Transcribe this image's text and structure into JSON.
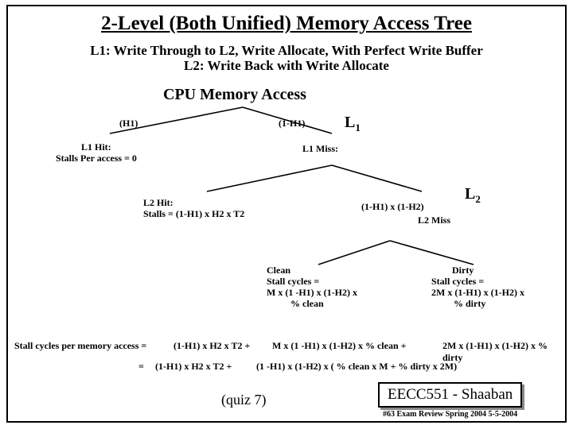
{
  "title": "2-Level (Both Unified) Memory Access Tree",
  "subtitle_line1": "L1: Write Through to L2, Write Allocate, With Perfect Write Buffer",
  "subtitle_line2": "L2: Write Back with Write Allocate",
  "section": "CPU Memory  Access",
  "labels": {
    "h1": "(H1)",
    "one_minus_h1": "(1-H1)",
    "L1": "L",
    "L1_sub": "1",
    "L2": "L",
    "L2_sub": "2",
    "l1_hit_line1": "L1 Hit:",
    "l1_hit_line2": "Stalls Per access = 0",
    "l1_miss": "L1 Miss:",
    "l2_hit_line1": "L2 Hit:",
    "l2_hit_line2": "Stalls =  (1-H1) x H2 x T2",
    "l2_right": "(1-H1) x (1-H2)",
    "l2_miss": "L2 Miss",
    "clean_line1": "Clean",
    "clean_line2": "Stall cycles =",
    "clean_line3": "M x (1 -H1)  x (1-H2) x",
    "clean_line4": "% clean",
    "dirty_line1": "Dirty",
    "dirty_line2": "Stall cycles =",
    "dirty_line3": "2M x (1-H1)  x (1-H2) x",
    "dirty_line4": "% dirty",
    "eq_lhs": "Stall cycles per memory access =",
    "eq_rhs1a": "(1-H1) x H2 x T2 +",
    "eq_rhs1b": "M x (1 -H1)  x (1-H2)  x  % clean   +",
    "eq_rhs1c": "2M x (1-H1)  x (1-H2) x % dirty",
    "eq_eq": "=",
    "eq_rhs2a": "(1-H1) x H2 x T2 +",
    "eq_rhs2b": "(1 -H1)  x (1-H2)  x  ( % clean  x M  +   % dirty x 2M)",
    "quiz": "(quiz 7)",
    "course": "EECC551 - Shaaban",
    "footer": "#63   Exam Review Spring 2004  5-5-2004"
  }
}
